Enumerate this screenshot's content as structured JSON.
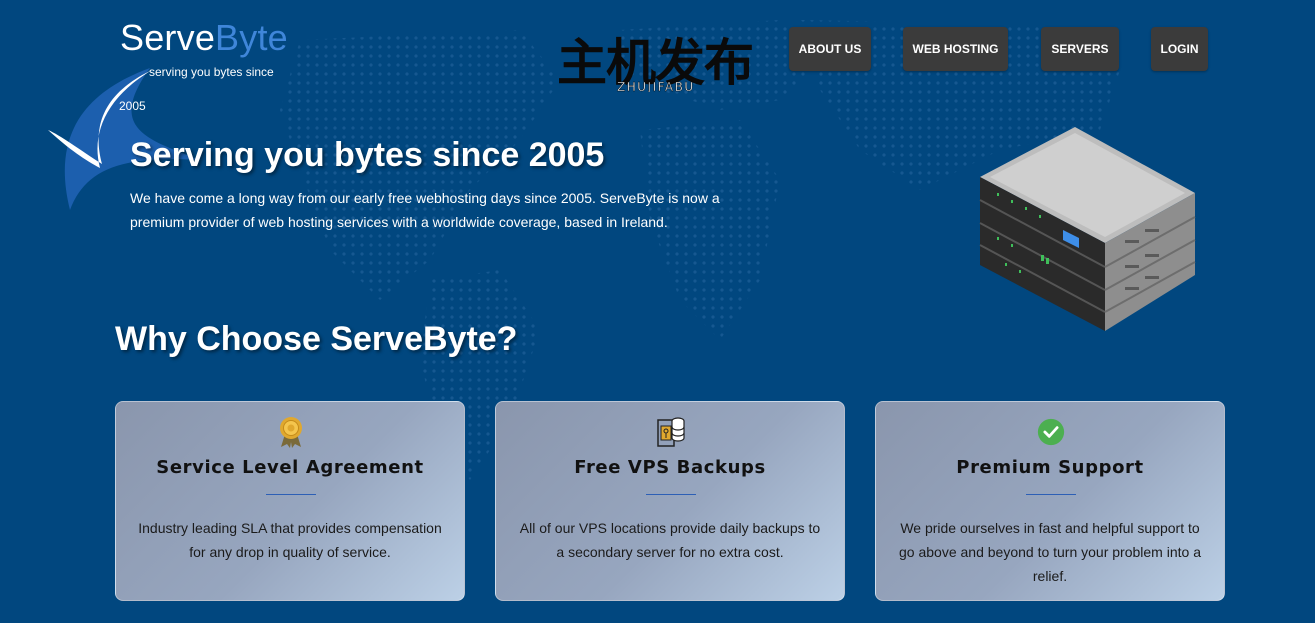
{
  "brand": {
    "name_part1": "Serve",
    "name_part2": "Byte",
    "tagline_line1": "serving you bytes since",
    "tagline_line2": "2005"
  },
  "watermark": {
    "chinese": "主机发布",
    "latin": "ZHUJIFABU"
  },
  "nav": [
    {
      "label": "ABOUT US"
    },
    {
      "label": "WEB HOSTING"
    },
    {
      "label": "SERVERS"
    },
    {
      "label": "LOGIN"
    }
  ],
  "hero": {
    "title": "Serving you bytes since 2005",
    "description": "We have come a long way from our early free webhosting days since 2005. ServeByte is now a premium provider of web hosting services with a worldwide coverage, based in Ireland."
  },
  "why": {
    "title": "Why Choose ServeByte?"
  },
  "cards": [
    {
      "icon": "award-badge-icon",
      "title": "Service Level Agreement",
      "text": "Industry leading SLA that provides compensation for any drop in quality of service."
    },
    {
      "icon": "database-backup-icon",
      "title": "Free VPS Backups",
      "text": "All of our VPS locations provide daily backups to a secondary server for no extra cost."
    },
    {
      "icon": "check-circle-icon",
      "title": "Premium Support",
      "text": "We pride ourselves in fast and helpful support to go above and beyond to turn your problem into a relief."
    }
  ],
  "colors": {
    "background": "#01477f",
    "brand_accent": "#3f86d9",
    "nav_button": "#3b3b3b",
    "check_green": "#4caf50",
    "badge_gold": "#e0a82e"
  }
}
